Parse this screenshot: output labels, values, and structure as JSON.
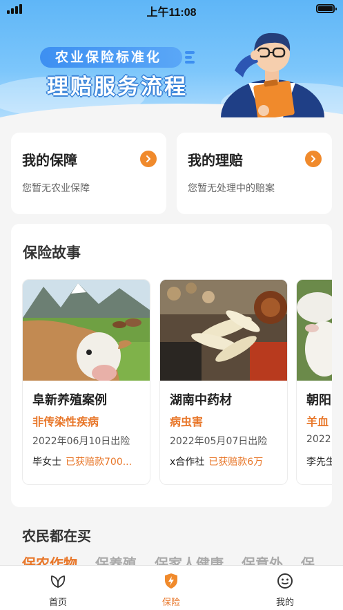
{
  "status_bar": {
    "time": "上午11:08"
  },
  "banner": {
    "tag": "农业保险标准化",
    "title": "理赔服务流程"
  },
  "quick_cards": [
    {
      "title": "我的保障",
      "subtitle": "您暂无农业保障"
    },
    {
      "title": "我的理赔",
      "subtitle": "您暂无处理中的赔案"
    }
  ],
  "stories": {
    "title": "保险故事",
    "items": [
      {
        "title": "阜新养殖案例",
        "tag": "非传染性疾病",
        "date": "2022年06月10日出险",
        "person": "毕女士",
        "amount": "已获赔款700..."
      },
      {
        "title": "湖南中药材",
        "tag": "病虫害",
        "date": "2022年05月07日出险",
        "person": "x合作社",
        "amount": "已获赔款6万"
      },
      {
        "title": "朝阳",
        "tag": "羊血",
        "date": "2022",
        "person": "李先生",
        "amount": ""
      }
    ]
  },
  "farmers_buy": {
    "title": "农民都在买",
    "categories": [
      "保农作物",
      "保养殖",
      "保家人健康",
      "保意外",
      "保"
    ],
    "active_index": 0
  },
  "tabbar": {
    "items": [
      {
        "label": "首页",
        "icon": "leaf-icon"
      },
      {
        "label": "保险",
        "icon": "shield-bolt-icon"
      },
      {
        "label": "我的",
        "icon": "smile-icon"
      }
    ],
    "active_index": 1
  },
  "colors": {
    "accent": "#e8772a",
    "arrow_button": "#f08a2c",
    "banner_blue": "#5fb6f7"
  }
}
